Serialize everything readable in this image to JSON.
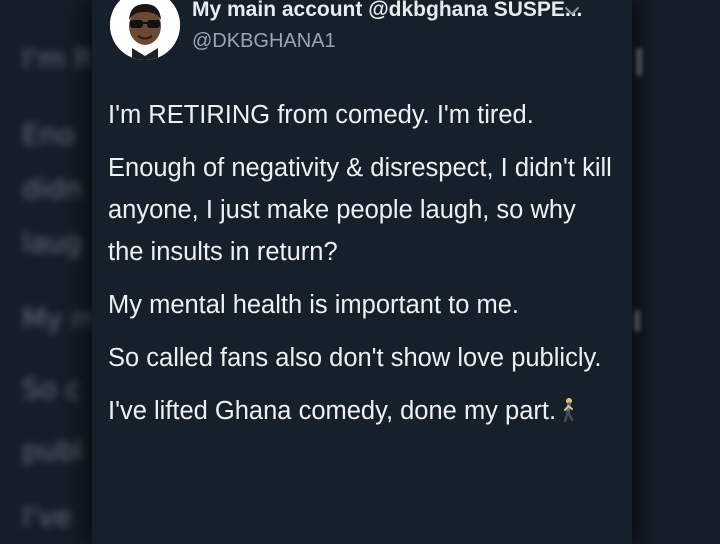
{
  "background": {
    "blurred_lines": [
      "I'm R",
      "Eno",
      "didn",
      "laug",
      "My m",
      "So c",
      "publ",
      "I've"
    ]
  },
  "tweet": {
    "display_name": "My main account @dkbghana SUSPE...",
    "handle": "@DKBGHANA1",
    "avatar_icon": "avatar-icon",
    "menu_icon": "chevron-down-icon",
    "paragraphs": [
      "I'm RETIRING from comedy. I'm tired.",
      "Enough of negativity & disrespect, I didn't kill anyone, I just make people laugh, so why the insults in return?",
      "My mental health is important to me.",
      "So called fans also don't show love publicly.",
      "I've lifted Ghana comedy, done my part."
    ],
    "emoji": "person-walking-emoji"
  },
  "colors": {
    "background": "#15202b",
    "text": "#e7ecef",
    "secondary_text": "#9aa6b2"
  }
}
